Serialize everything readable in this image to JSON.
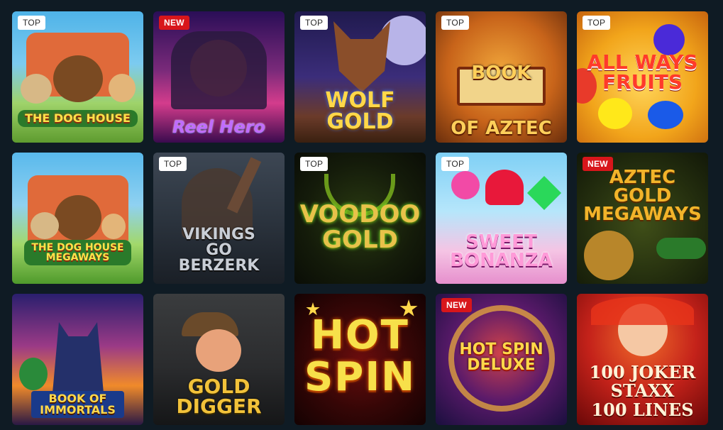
{
  "games": [
    {
      "title": "THE DOG HOUSE",
      "badge": "TOP",
      "badge_type": "top",
      "art": "t-doghouse"
    },
    {
      "title": "Reel Hero",
      "badge": "NEW",
      "badge_type": "new",
      "art": "t-reelhero"
    },
    {
      "title": "WOLF\nGOLD",
      "badge": "TOP",
      "badge_type": "top",
      "art": "t-wolf"
    },
    {
      "title": "BOOK\nOF AZTEC",
      "badge": "TOP",
      "badge_type": "top",
      "art": "t-aztec"
    },
    {
      "title": "ALL WAYS\nFRUITS",
      "badge": "TOP",
      "badge_type": "top",
      "art": "t-fruits"
    },
    {
      "title": "THE DOG HOUSE\nMEGAWAYS",
      "badge": "",
      "badge_type": "none",
      "art": "t-dogmega"
    },
    {
      "title": "VIKINGS\nGO\nBERZERK",
      "badge": "TOP",
      "badge_type": "top",
      "art": "t-vikings"
    },
    {
      "title": "VOODOO\nGOLD",
      "badge": "TOP",
      "badge_type": "top",
      "art": "t-voodoo"
    },
    {
      "title": "SWEET\nBONANZA",
      "badge": "TOP",
      "badge_type": "top",
      "art": "t-sweet"
    },
    {
      "title": "AZTEC\nGOLD\nMEGAWAYS",
      "badge": "NEW",
      "badge_type": "new",
      "art": "t-aztecgold"
    },
    {
      "title": "BOOK OF\nIMMORTALS",
      "badge": "",
      "badge_type": "none",
      "art": "t-immortals"
    },
    {
      "title": "GOLD\nDIGGER",
      "badge": "",
      "badge_type": "none",
      "art": "t-golddigger"
    },
    {
      "title": "HOT\nSPIN",
      "badge": "",
      "badge_type": "none",
      "art": "t-hotspin"
    },
    {
      "title": "HOT SPIN\nDELUXE",
      "badge": "NEW",
      "badge_type": "new",
      "art": "t-hotspindlx"
    },
    {
      "title": "100 JOKER\nSTAXX\n100 LINES",
      "badge": "",
      "badge_type": "none",
      "art": "t-joker"
    }
  ],
  "colors": {
    "background": "#0f1b24",
    "badge_top_bg": "#ffffff",
    "badge_new_bg": "#d8161b"
  }
}
